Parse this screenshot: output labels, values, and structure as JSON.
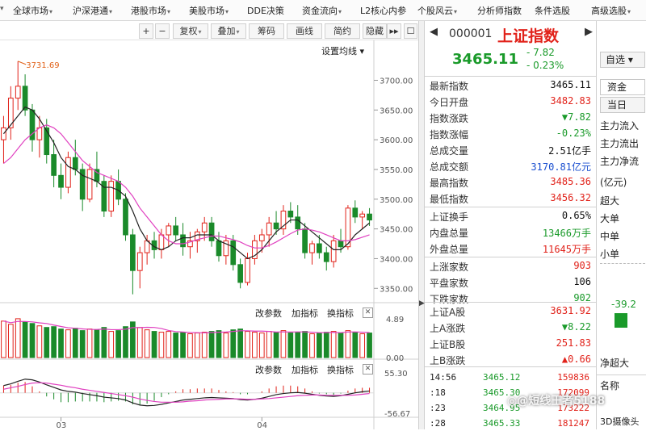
{
  "menu": {
    "items": [
      "全球市场",
      "沪深港通",
      "港股市场",
      "美股市场",
      "DDE决策",
      "资金流向",
      "L2核心内参",
      "个股风云",
      "分析师指数",
      "条件选股",
      "高级选股"
    ]
  },
  "toolbar": {
    "plus": "+",
    "minus": "−",
    "fuquan": "复权",
    "diejia": "叠加",
    "chouma": "筹码",
    "huaxian": "画线",
    "jianyue": "简约",
    "yincang": "隐藏",
    "more": "▸▸",
    "square": "☐"
  },
  "chart": {
    "ma_setting": "设置均线",
    "max_marker": "3731.69",
    "y_ticks": [
      "3700.00",
      "3650.00",
      "3600.00",
      "3550.00",
      "3500.00",
      "3450.00",
      "3400.00",
      "3350.00"
    ],
    "vol_ticks": [
      "4.89",
      "0.00"
    ],
    "macd_ticks": [
      "55.30",
      "-56.67"
    ],
    "x_labels": [
      "03",
      "04"
    ],
    "ind1": {
      "edit": "改参数",
      "add": "加指标",
      "switch": "换指标",
      "close": "✕"
    },
    "ind2": {
      "edit": "改参数",
      "add": "加指标",
      "switch": "换指标",
      "close": "✕"
    }
  },
  "chart_data": {
    "type": "candlestick",
    "ylim": [
      3330,
      3740
    ],
    "candles": [
      [
        3600,
        3640,
        3560,
        3620
      ],
      [
        3620,
        3690,
        3600,
        3670
      ],
      [
        3670,
        3732,
        3650,
        3690
      ],
      [
        3690,
        3710,
        3640,
        3650
      ],
      [
        3650,
        3660,
        3580,
        3600
      ],
      [
        3600,
        3640,
        3570,
        3620
      ],
      [
        3620,
        3635,
        3560,
        3575
      ],
      [
        3575,
        3600,
        3520,
        3540
      ],
      [
        3540,
        3560,
        3500,
        3520
      ],
      [
        3520,
        3580,
        3510,
        3570
      ],
      [
        3570,
        3600,
        3540,
        3550
      ],
      [
        3550,
        3560,
        3480,
        3500
      ],
      [
        3500,
        3560,
        3495,
        3550
      ],
      [
        3550,
        3580,
        3520,
        3530
      ],
      [
        3530,
        3540,
        3470,
        3480
      ],
      [
        3480,
        3540,
        3470,
        3530
      ],
      [
        3530,
        3550,
        3490,
        3500
      ],
      [
        3500,
        3510,
        3430,
        3440
      ],
      [
        3440,
        3450,
        3340,
        3380
      ],
      [
        3380,
        3420,
        3350,
        3410
      ],
      [
        3410,
        3440,
        3390,
        3430
      ],
      [
        3430,
        3445,
        3400,
        3415
      ],
      [
        3415,
        3450,
        3400,
        3440
      ],
      [
        3440,
        3460,
        3420,
        3455
      ],
      [
        3455,
        3470,
        3430,
        3440
      ],
      [
        3440,
        3460,
        3405,
        3420
      ],
      [
        3420,
        3445,
        3400,
        3430
      ],
      [
        3430,
        3450,
        3410,
        3445
      ],
      [
        3445,
        3470,
        3430,
        3460
      ],
      [
        3460,
        3470,
        3420,
        3430
      ],
      [
        3430,
        3445,
        3395,
        3405
      ],
      [
        3405,
        3440,
        3390,
        3430
      ],
      [
        3430,
        3440,
        3380,
        3390
      ],
      [
        3390,
        3400,
        3350,
        3360
      ],
      [
        3360,
        3410,
        3355,
        3400
      ],
      [
        3400,
        3440,
        3390,
        3430
      ],
      [
        3430,
        3450,
        3410,
        3440
      ],
      [
        3440,
        3470,
        3420,
        3460
      ],
      [
        3460,
        3480,
        3440,
        3450
      ],
      [
        3450,
        3490,
        3440,
        3480
      ],
      [
        3480,
        3495,
        3460,
        3470
      ],
      [
        3470,
        3490,
        3440,
        3450
      ],
      [
        3450,
        3460,
        3400,
        3410
      ],
      [
        3410,
        3430,
        3390,
        3425
      ],
      [
        3425,
        3440,
        3400,
        3410
      ],
      [
        3410,
        3420,
        3380,
        3395
      ],
      [
        3395,
        3440,
        3385,
        3430
      ],
      [
        3430,
        3450,
        3410,
        3420
      ],
      [
        3420,
        3490,
        3415,
        3485
      ],
      [
        3485,
        3498,
        3460,
        3470
      ],
      [
        3470,
        3480,
        3450,
        3475
      ],
      [
        3475,
        3485,
        3455,
        3465
      ]
    ],
    "ma5": [
      3610,
      3625,
      3640,
      3655,
      3650,
      3635,
      3615,
      3595,
      3570,
      3555,
      3550,
      3540,
      3535,
      3530,
      3520,
      3520,
      3515,
      3505,
      3480,
      3450,
      3430,
      3420,
      3415,
      3420,
      3430,
      3435,
      3435,
      3440,
      3440,
      3440,
      3430,
      3425,
      3420,
      3410,
      3400,
      3405,
      3415,
      3430,
      3445,
      3455,
      3465,
      3465,
      3455,
      3445,
      3435,
      3425,
      3415,
      3415,
      3425,
      3440,
      3450,
      3460
    ],
    "ma10": [
      3560,
      3570,
      3585,
      3600,
      3610,
      3620,
      3625,
      3620,
      3610,
      3595,
      3580,
      3565,
      3555,
      3545,
      3540,
      3535,
      3530,
      3520,
      3505,
      3485,
      3470,
      3455,
      3440,
      3430,
      3425,
      3425,
      3428,
      3432,
      3435,
      3438,
      3438,
      3435,
      3432,
      3428,
      3422,
      3418,
      3418,
      3422,
      3428,
      3435,
      3442,
      3448,
      3450,
      3448,
      3445,
      3440,
      3435,
      3430,
      3430,
      3432,
      3436,
      3440
    ],
    "volume": [
      4.6,
      4.2,
      4.9,
      4.5,
      4.3,
      4.0,
      3.8,
      3.9,
      3.6,
      3.5,
      3.7,
      3.4,
      3.6,
      3.5,
      3.8,
      3.3,
      3.4,
      3.9,
      4.5,
      3.8,
      3.5,
      3.3,
      3.2,
      3.3,
      3.1,
      3.2,
      3.0,
      3.1,
      3.2,
      3.3,
      3.4,
      3.1,
      3.5,
      3.6,
      3.3,
      3.2,
      3.1,
      3.3,
      3.2,
      3.4,
      3.1,
      3.2,
      3.3,
      3.0,
      3.1,
      3.2,
      3.3,
      3.1,
      3.4,
      3.2,
      3.0,
      3.1
    ],
    "macd_dif": [
      20,
      25,
      32,
      38,
      36,
      30,
      22,
      15,
      8,
      4,
      2,
      -2,
      -5,
      -8,
      -12,
      -14,
      -16,
      -20,
      -28,
      -34,
      -36,
      -35,
      -32,
      -28,
      -24,
      -20,
      -18,
      -16,
      -14,
      -13,
      -14,
      -15,
      -16,
      -19,
      -20,
      -18,
      -15,
      -10,
      -5,
      -2,
      0,
      1,
      -1,
      -4,
      -7,
      -9,
      -10,
      -8,
      -4,
      0,
      3,
      5
    ],
    "macd_dea": [
      10,
      14,
      18,
      23,
      27,
      28,
      27,
      24,
      21,
      17,
      14,
      10,
      7,
      4,
      1,
      -2,
      -5,
      -8,
      -12,
      -17,
      -21,
      -24,
      -26,
      -26,
      -26,
      -25,
      -23,
      -22,
      -20,
      -19,
      -18,
      -17,
      -17,
      -17,
      -18,
      -18,
      -17,
      -16,
      -14,
      -12,
      -10,
      -8,
      -7,
      -6,
      -6,
      -7,
      -7,
      -7,
      -7,
      -6,
      -4,
      -2
    ]
  },
  "quote": {
    "code": "000001",
    "name": "上证指数",
    "price": "3465.11",
    "change": "- 7.82",
    "change_pct": "- 0.23%",
    "zixuan": "自选",
    "rows1": [
      {
        "label": "最新指数",
        "value": "3465.11",
        "cls": "blk"
      },
      {
        "label": "今日开盘",
        "value": "3482.83",
        "cls": "red"
      },
      {
        "label": "指数涨跌",
        "value": "▼7.82",
        "cls": "green"
      },
      {
        "label": "指数涨幅",
        "value": "-0.23%",
        "cls": "green"
      },
      {
        "label": "总成交量",
        "value": "2.51亿手",
        "cls": "blk"
      },
      {
        "label": "总成交额",
        "value": "3170.81亿元",
        "cls": "blue"
      },
      {
        "label": "最高指数",
        "value": "3485.36",
        "cls": "red"
      },
      {
        "label": "最低指数",
        "value": "3456.32",
        "cls": "red"
      }
    ],
    "rows2": [
      {
        "label": "上证换手",
        "value": "0.65%",
        "cls": "blk"
      },
      {
        "label": "内盘总量",
        "value": "13466万手",
        "cls": "green"
      },
      {
        "label": "外盘总量",
        "value": "11645万手",
        "cls": "red"
      }
    ],
    "rows3": [
      {
        "label": "上涨家数",
        "value": "903",
        "cls": "red"
      },
      {
        "label": "平盘家数",
        "value": "106",
        "cls": "blk"
      },
      {
        "label": "下跌家数",
        "value": "902",
        "cls": "green"
      }
    ],
    "rows4": [
      {
        "label": "上证A股",
        "value": "3631.92",
        "cls": "red"
      },
      {
        "label": "上A涨跌",
        "value": "▼8.22",
        "cls": "green"
      },
      {
        "label": "上证B股",
        "value": "251.83",
        "cls": "red"
      },
      {
        "label": "上B涨跌",
        "value": "▲0.66",
        "cls": "red"
      }
    ],
    "ticks": [
      {
        "time": "14:56",
        "price": "3465.12",
        "vol": "159836"
      },
      {
        "time": ":18",
        "price": "3465.30",
        "vol": "172099"
      },
      {
        "time": ":23",
        "price": "3464.95",
        "vol": "173222"
      },
      {
        "time": ":28",
        "price": "3465.33",
        "vol": "181247"
      }
    ]
  },
  "rightcol": {
    "tab1": "资金",
    "tab2": "当日",
    "labels": [
      "主力流入",
      "主力流出",
      "主力净流"
    ],
    "unit": "(亿元)",
    "sizes": [
      "超大",
      "大单",
      "中单",
      "小单"
    ],
    "bar_value": "-39.2",
    "bottom1": "净超大",
    "bottom2": "名称",
    "bottom3": "3D摄像头"
  },
  "watermark": "@短线王者5188"
}
